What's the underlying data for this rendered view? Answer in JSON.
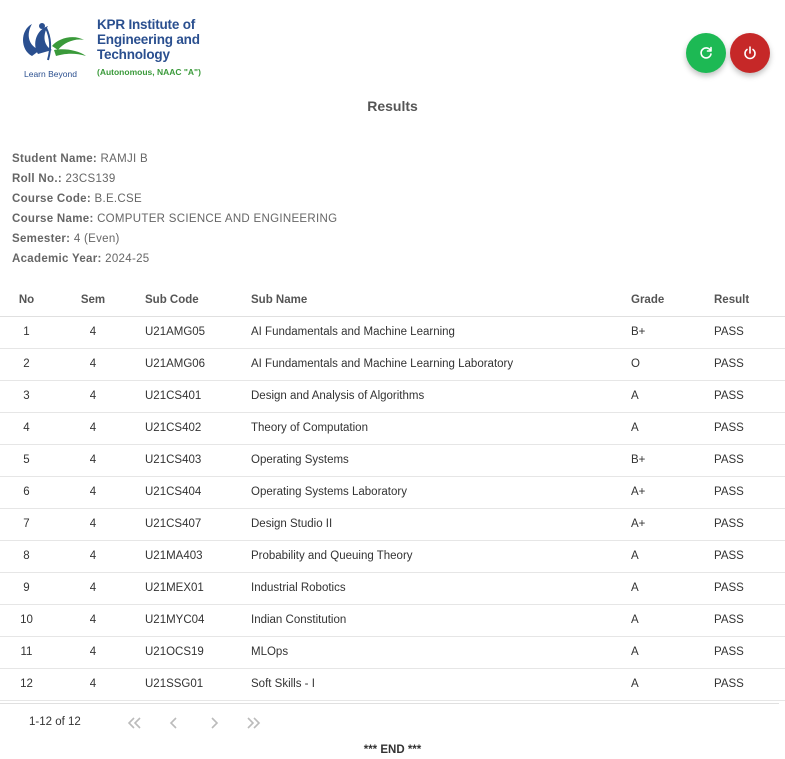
{
  "logo": {
    "name_line1": "KPR Institute of",
    "name_line2": "Engineering and",
    "name_line3": "Technology",
    "subtitle": "(Autonomous, NAAC \"A\")",
    "tagline": "Learn Beyond"
  },
  "page": {
    "title": "Results",
    "footer": "*** END ***"
  },
  "student": {
    "fields": [
      {
        "label": "Student Name:",
        "value": "RAMJI B"
      },
      {
        "label": "Roll No.:",
        "value": "23CS139"
      },
      {
        "label": "Course Code:",
        "value": "B.E.CSE"
      },
      {
        "label": "Course Name:",
        "value": "COMPUTER SCIENCE AND ENGINEERING"
      },
      {
        "label": "Semester:",
        "value": "4 (Even)"
      },
      {
        "label": "Academic Year:",
        "value": "2024-25"
      }
    ]
  },
  "table": {
    "headers": [
      "No",
      "Sem",
      "Sub Code",
      "Sub Name",
      "Grade",
      "Result"
    ],
    "rows": [
      [
        "1",
        "4",
        "U21AMG05",
        "AI Fundamentals and Machine Learning",
        "B+",
        "PASS"
      ],
      [
        "2",
        "4",
        "U21AMG06",
        "AI Fundamentals and Machine Learning Laboratory",
        "O",
        "PASS"
      ],
      [
        "3",
        "4",
        "U21CS401",
        "Design and Analysis of Algorithms",
        "A",
        "PASS"
      ],
      [
        "4",
        "4",
        "U21CS402",
        "Theory of Computation",
        "A",
        "PASS"
      ],
      [
        "5",
        "4",
        "U21CS403",
        "Operating Systems",
        "B+",
        "PASS"
      ],
      [
        "6",
        "4",
        "U21CS404",
        "Operating Systems Laboratory",
        "A+",
        "PASS"
      ],
      [
        "7",
        "4",
        "U21CS407",
        "Design Studio II",
        "A+",
        "PASS"
      ],
      [
        "8",
        "4",
        "U21MA403",
        "Probability and Queuing Theory",
        "A",
        "PASS"
      ],
      [
        "9",
        "4",
        "U21MEX01",
        "Industrial Robotics",
        "A",
        "PASS"
      ],
      [
        "10",
        "4",
        "U21MYC04",
        "Indian Constitution",
        "A",
        "PASS"
      ],
      [
        "11",
        "4",
        "U21OCS19",
        "MLOps",
        "A",
        "PASS"
      ],
      [
        "12",
        "4",
        "U21SSG01",
        "Soft Skills - I",
        "A",
        "PASS"
      ]
    ]
  },
  "pagination": {
    "range": "1-12 of 12"
  },
  "actions": {
    "refresh_icon": "refresh-icon",
    "logout_icon": "power-icon",
    "refresh_color": "#1db954",
    "logout_color": "#c62828"
  }
}
